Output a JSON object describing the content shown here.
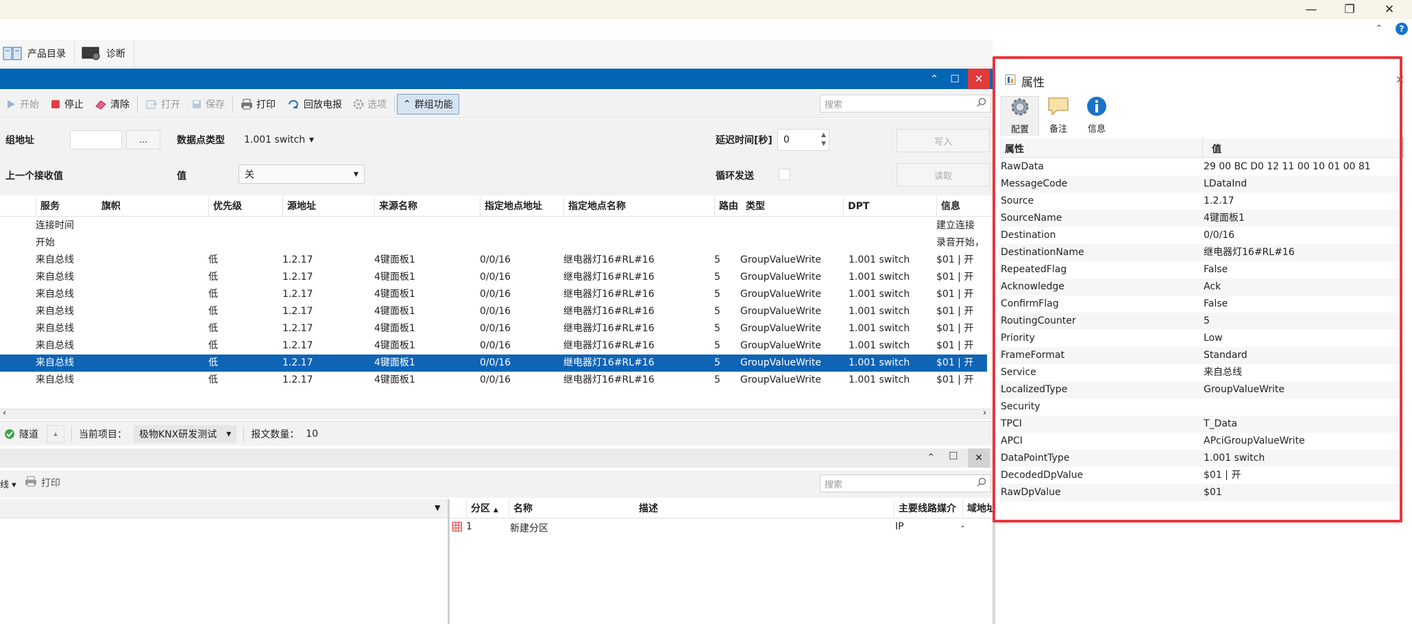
{
  "window": {
    "minimize": "—",
    "restore": "❐",
    "close": "✕"
  },
  "menubar": {
    "items": [
      {
        "label": "产品目录"
      },
      {
        "label": "诊断"
      }
    ]
  },
  "toolbar": {
    "start": "开始",
    "stop": "停止",
    "clear": "清除",
    "open": "打开",
    "save": "保存",
    "print": "打印",
    "replay": "回放电报",
    "options": "选项",
    "group_func": "群组功能",
    "search_placeholder": "搜索"
  },
  "filter": {
    "group_address_label": "组地址",
    "browse_btn": "...",
    "dpt_label": "数据点类型",
    "dpt_value": "1.001 switch",
    "delay_label": "延迟时间[秒]",
    "delay_value": "0",
    "write_btn": "写入",
    "read_btn": "读取",
    "last_value_label": "上一个接收值",
    "value_label": "值",
    "value_value": "关",
    "cyclic_label": "循环发送"
  },
  "grid": {
    "columns": [
      "服务",
      "旗帜",
      "优先级",
      "源地址",
      "来源名称",
      "指定地点地址",
      "指定地点名称",
      "路由",
      "类型",
      "DPT",
      "信息"
    ],
    "rows": [
      {
        "service": "连接时间",
        "priority": "",
        "src": "",
        "src_name": "",
        "dst": "",
        "dst_name": "",
        "route": "",
        "type": "",
        "dpt": "",
        "info": "建立连接"
      },
      {
        "service": "开始",
        "priority": "",
        "src": "",
        "src_name": "",
        "dst": "",
        "dst_name": "",
        "route": "",
        "type": "",
        "dpt": "",
        "info": "录音开始，"
      },
      {
        "service": "来自总线",
        "priority": "低",
        "src": "1.2.17",
        "src_name": "4键面板1",
        "dst": "0/0/16",
        "dst_name": "继电器灯16#RL#16",
        "route": "5",
        "type": "GroupValueWrite",
        "dpt": "1.001 switch",
        "info": "$01 | 开"
      },
      {
        "service": "来自总线",
        "priority": "低",
        "src": "1.2.17",
        "src_name": "4键面板1",
        "dst": "0/0/16",
        "dst_name": "继电器灯16#RL#16",
        "route": "5",
        "type": "GroupValueWrite",
        "dpt": "1.001 switch",
        "info": "$01 | 开"
      },
      {
        "service": "来自总线",
        "priority": "低",
        "src": "1.2.17",
        "src_name": "4键面板1",
        "dst": "0/0/16",
        "dst_name": "继电器灯16#RL#16",
        "route": "5",
        "type": "GroupValueWrite",
        "dpt": "1.001 switch",
        "info": "$01 | 开"
      },
      {
        "service": "来自总线",
        "priority": "低",
        "src": "1.2.17",
        "src_name": "4键面板1",
        "dst": "0/0/16",
        "dst_name": "继电器灯16#RL#16",
        "route": "5",
        "type": "GroupValueWrite",
        "dpt": "1.001 switch",
        "info": "$01 | 开"
      },
      {
        "service": "来自总线",
        "priority": "低",
        "src": "1.2.17",
        "src_name": "4键面板1",
        "dst": "0/0/16",
        "dst_name": "继电器灯16#RL#16",
        "route": "5",
        "type": "GroupValueWrite",
        "dpt": "1.001 switch",
        "info": "$01 | 开"
      },
      {
        "service": "来自总线",
        "priority": "低",
        "src": "1.2.17",
        "src_name": "4键面板1",
        "dst": "0/0/16",
        "dst_name": "继电器灯16#RL#16",
        "route": "5",
        "type": "GroupValueWrite",
        "dpt": "1.001 switch",
        "info": "$01 | 开"
      },
      {
        "service": "来自总线",
        "priority": "低",
        "src": "1.2.17",
        "src_name": "4键面板1",
        "dst": "0/0/16",
        "dst_name": "继电器灯16#RL#16",
        "route": "5",
        "type": "GroupValueWrite",
        "dpt": "1.001 switch",
        "info": "$01 | 开"
      },
      {
        "service": "来自总线",
        "priority": "低",
        "src": "1.2.17",
        "src_name": "4键面板1",
        "dst": "0/0/16",
        "dst_name": "继电器灯16#RL#16",
        "route": "5",
        "type": "GroupValueWrite",
        "dpt": "1.001 switch",
        "info": "$01 | 开"
      }
    ],
    "selected_row": 8
  },
  "status": {
    "tunnel": "隧道",
    "project_label": "当前项目：",
    "project_value": "极物KNX研发测试",
    "count_label": "报文数量：",
    "count_value": "10"
  },
  "lower": {
    "toolbar_partial": "线 ▾",
    "print": "打印",
    "search_placeholder": "搜索",
    "columns": [
      "分区",
      "名称",
      "描述",
      "主要线路媒介",
      "域地址"
    ],
    "row": {
      "index": "1",
      "name": "新建分区",
      "medium": "IP",
      "domain": "-"
    }
  },
  "properties": {
    "title": "属性",
    "tabs": [
      {
        "label": "配置"
      },
      {
        "label": "备注"
      },
      {
        "label": "信息"
      }
    ],
    "col_key": "属性",
    "col_value": "值",
    "rows": [
      {
        "k": "RawData",
        "v": "29 00 BC D0 12 11 00 10 01 00 81"
      },
      {
        "k": "MessageCode",
        "v": "LDataInd"
      },
      {
        "k": "Source",
        "v": "1.2.17"
      },
      {
        "k": "SourceName",
        "v": "4键面板1"
      },
      {
        "k": "Destination",
        "v": "0/0/16"
      },
      {
        "k": "DestinationName",
        "v": "继电器灯16#RL#16"
      },
      {
        "k": "RepeatedFlag",
        "v": "False"
      },
      {
        "k": "Acknowledge",
        "v": "Ack"
      },
      {
        "k": "ConfirmFlag",
        "v": "False"
      },
      {
        "k": "RoutingCounter",
        "v": "5"
      },
      {
        "k": "Priority",
        "v": "Low"
      },
      {
        "k": "FrameFormat",
        "v": "Standard"
      },
      {
        "k": "Service",
        "v": "来自总线"
      },
      {
        "k": "LocalizedType",
        "v": "GroupValueWrite"
      },
      {
        "k": "Security",
        "v": ""
      },
      {
        "k": "TPCI",
        "v": "T_Data"
      },
      {
        "k": "APCI",
        "v": "APciGroupValueWrite"
      },
      {
        "k": "DataPointType",
        "v": " 1.001 switch"
      },
      {
        "k": "DecodedDpValue",
        "v": "$01 | 开"
      },
      {
        "k": "RawDpValue",
        "v": "$01"
      }
    ]
  },
  "colors": {
    "accent": "#0565b5",
    "selection": "#0f64b5",
    "highlight": "#e5373d"
  }
}
